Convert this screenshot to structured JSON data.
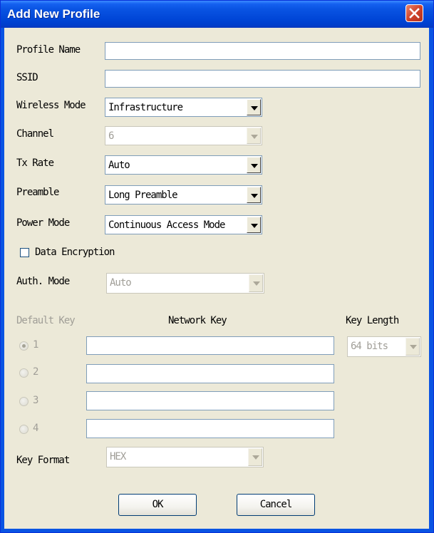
{
  "window": {
    "title": "Add New Profile"
  },
  "labels": {
    "profile_name": "Profile Name",
    "ssid": "SSID",
    "wireless_mode": "Wireless Mode",
    "channel": "Channel",
    "tx_rate": "Tx Rate",
    "preamble": "Preamble",
    "power_mode": "Power Mode",
    "data_encryption": "Data Encryption",
    "auth_mode": "Auth. Mode",
    "default_key": "Default Key",
    "network_key": "Network Key",
    "key_length": "Key Length",
    "key_format": "Key Format"
  },
  "fields": {
    "profile_name": "",
    "ssid": "",
    "wireless_mode": "Infrastructure",
    "channel": "6",
    "tx_rate": "Auto",
    "preamble": "Long Preamble",
    "power_mode": "Continuous Access Mode",
    "data_encryption_checked": false,
    "auth_mode": "Auto",
    "key_length": "64 bits",
    "key_format": "HEX"
  },
  "keys": [
    {
      "label": "1",
      "selected": true,
      "value": ""
    },
    {
      "label": "2",
      "selected": false,
      "value": ""
    },
    {
      "label": "3",
      "selected": false,
      "value": ""
    },
    {
      "label": "4",
      "selected": false,
      "value": ""
    }
  ],
  "buttons": {
    "ok": "OK",
    "cancel": "Cancel"
  }
}
